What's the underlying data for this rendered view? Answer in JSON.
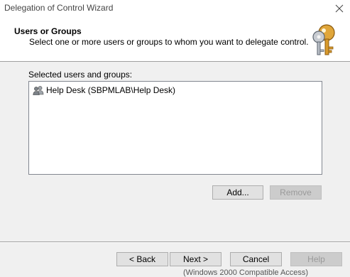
{
  "window": {
    "title": "Delegation of Control Wizard"
  },
  "header": {
    "title": "Users or Groups",
    "subtitle": "Select one or more users or groups to whom you want to delegate control."
  },
  "selection": {
    "label": "Selected users and groups:",
    "items": [
      {
        "label": "Help Desk (SBPMLAB\\Help Desk)",
        "icon": "user-group-icon"
      }
    ]
  },
  "buttons": {
    "add": "Add...",
    "remove": "Remove",
    "back": "< Back",
    "next": "Next >",
    "cancel": "Cancel",
    "help": "Help"
  },
  "status_fragment": "(Windows 2000 Compatible Access)",
  "colors": {
    "dialog_bg": "#f0f0f0",
    "header_bg": "#ffffff",
    "disabled_text": "#9a9a9a"
  }
}
